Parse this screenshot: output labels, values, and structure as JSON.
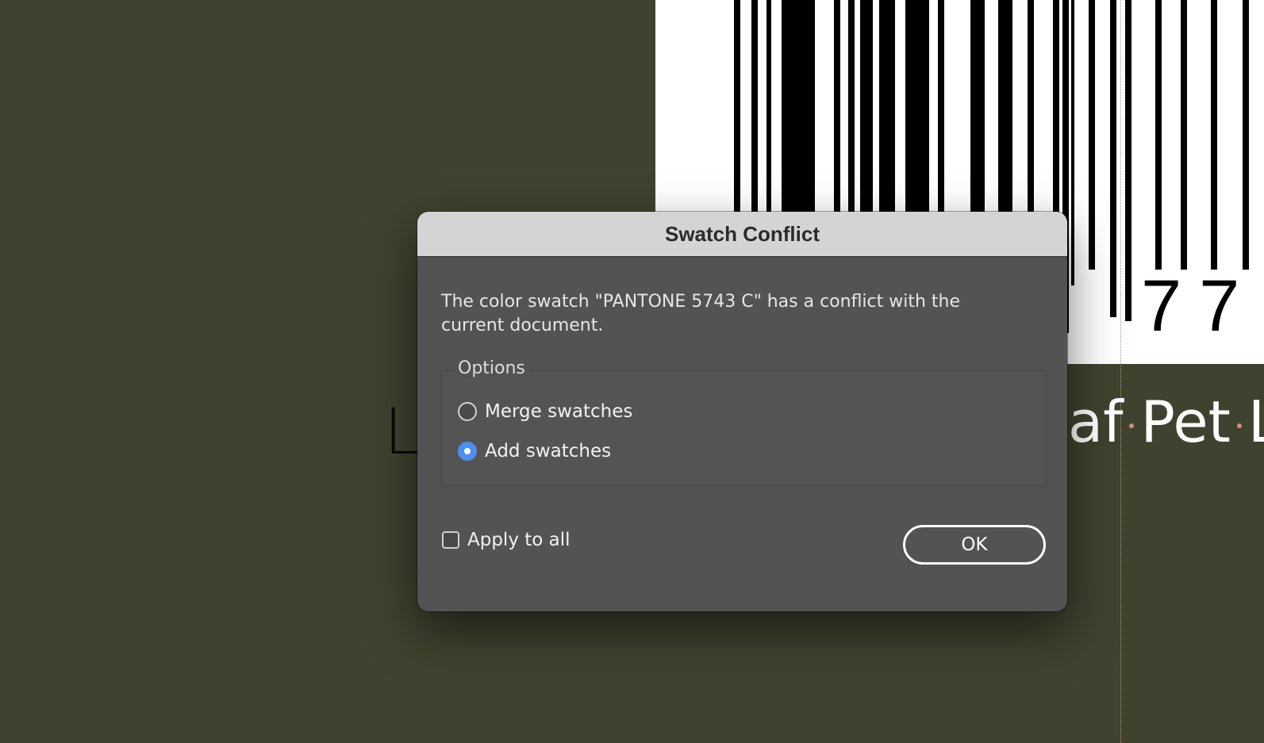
{
  "background": {
    "canvas_color": "#3e432f",
    "left_text": "Lo",
    "right_text_parts": [
      "af",
      "Pet",
      "L"
    ],
    "barcode_digits": "77"
  },
  "dialog": {
    "title": "Swatch Conflict",
    "message": "The color swatch \"PANTONE 5743 C\" has a conflict with the current document.",
    "options_group": {
      "legend": "Options",
      "choices": [
        {
          "label": "Merge swatches",
          "selected": false
        },
        {
          "label": "Add swatches",
          "selected": true
        }
      ]
    },
    "apply_to_all": {
      "label": "Apply to all",
      "checked": false
    },
    "ok_button_label": "OK",
    "accent_color": "#4d8ff0"
  }
}
